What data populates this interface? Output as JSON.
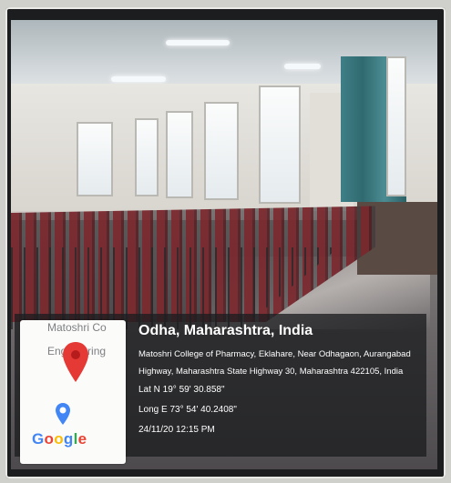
{
  "geotag": {
    "location_title": "Odha, Maharashtra, India",
    "address_line1": "Matoshri College of Pharmacy, Eklahare, Near Odhagaon, Aurangabad",
    "address_line2": "Highway, Maharashtra State Highway 30, Maharashtra 422105, India",
    "latitude": "Lat N 19° 59' 30.858\"",
    "longitude": "Long E 73° 54' 40.2408\"",
    "datetime": "24/11/20 12:15 PM"
  },
  "map_card": {
    "place_label_line1": "Matoshri Co",
    "place_label_line2": "Engineering",
    "brand": "Google",
    "pin_color": "#e53935"
  }
}
